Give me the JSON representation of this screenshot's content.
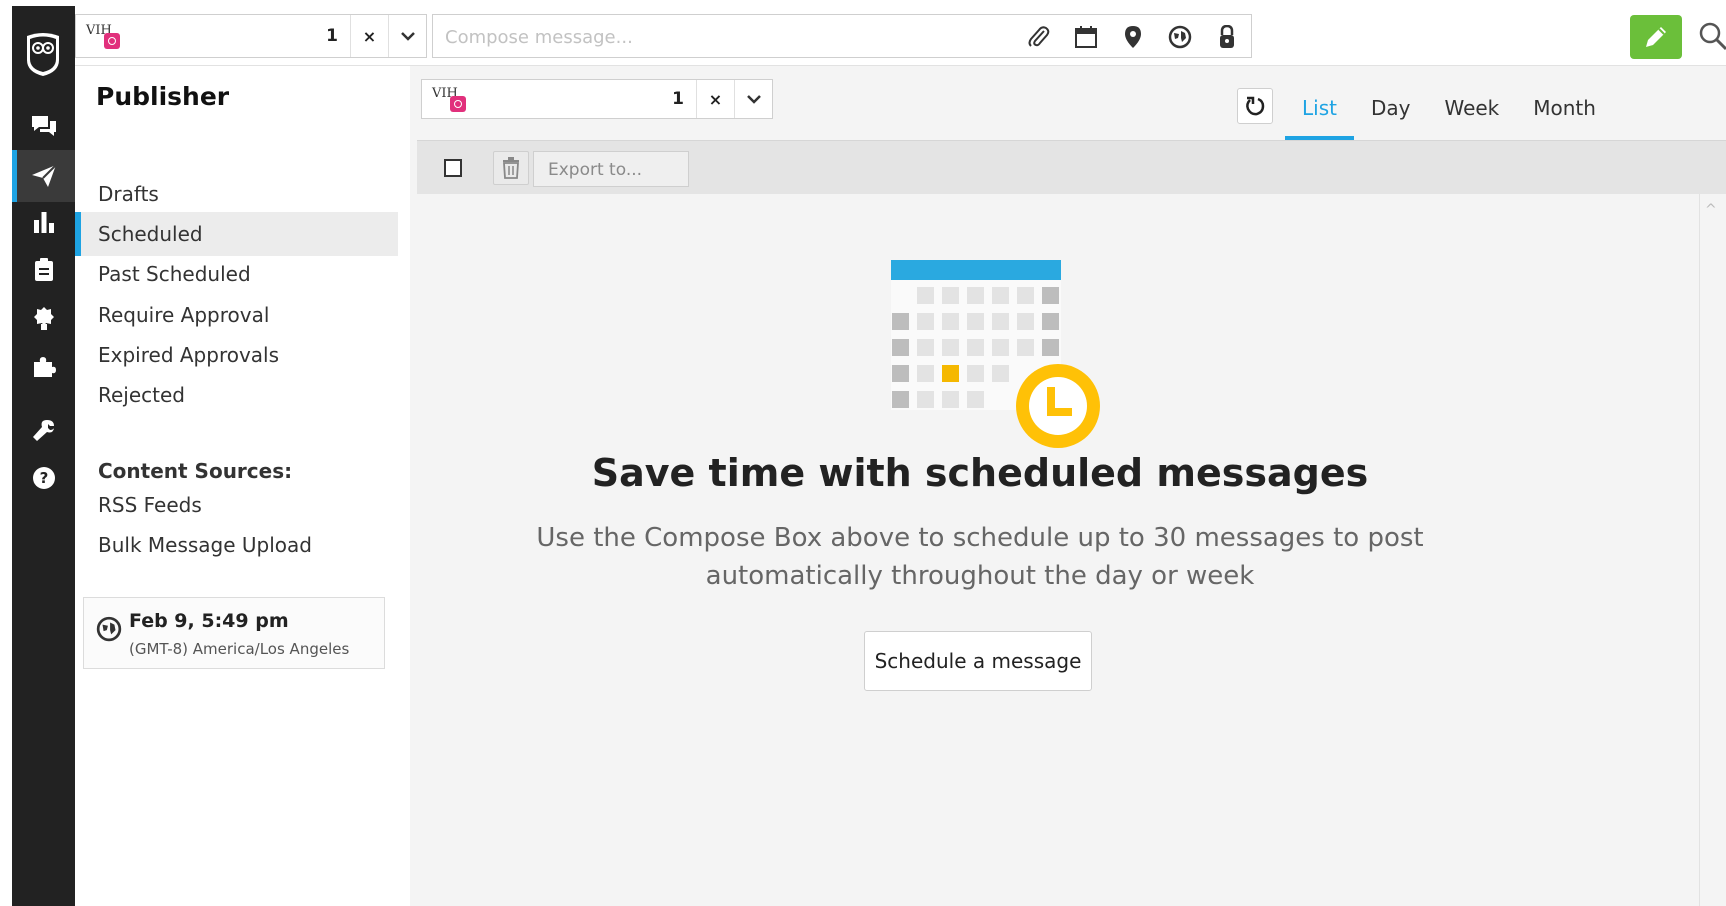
{
  "topbar": {
    "picker_count": "1",
    "picker_clear": "×",
    "compose_placeholder": "Compose message...",
    "avatar_text": "VIH"
  },
  "sidebar": {
    "title": "Publisher",
    "items": [
      {
        "label": "Drafts"
      },
      {
        "label": "Scheduled"
      },
      {
        "label": "Past Scheduled"
      },
      {
        "label": "Require Approval"
      },
      {
        "label": "Expired Approvals"
      },
      {
        "label": "Rejected"
      }
    ],
    "content_sources_heading": "Content Sources:",
    "sources": [
      {
        "label": "RSS Feeds"
      },
      {
        "label": "Bulk Message Upload"
      }
    ],
    "clock": {
      "date": "Feb 9, 5:49 pm",
      "timezone": "(GMT-8) America/Los Angeles"
    }
  },
  "main": {
    "picker_count": "1",
    "picker_clear": "×",
    "avatar_text": "VIH",
    "tabs": [
      {
        "label": "List"
      },
      {
        "label": "Day"
      },
      {
        "label": "Week"
      },
      {
        "label": "Month"
      }
    ],
    "export_placeholder": "Export to...",
    "empty_title": "Save time with scheduled messages",
    "empty_subtitle": "Use the Compose Box above to schedule up to 30 messages to post automatically throughout the day or week",
    "schedule_button": "Schedule a message"
  },
  "colors": {
    "accent": "#1ea3e3",
    "compose_green": "#6bbf3a",
    "clock_yellow": "#ffc107",
    "nav_bg": "#222222"
  }
}
